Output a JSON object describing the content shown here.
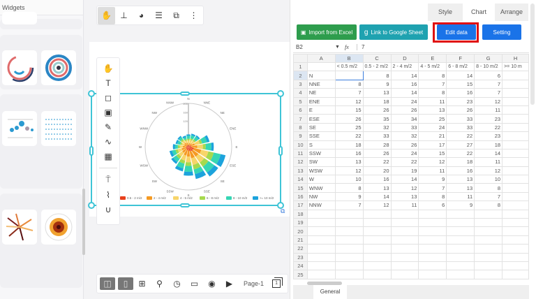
{
  "left_panel": {
    "title": "Widgets"
  },
  "top_toolbar": {
    "icons": [
      "hand-chart-icon",
      "tree-icon",
      "pie-icon",
      "sliders-icon",
      "replace-icon",
      "more-vertical-icon"
    ]
  },
  "vertical_toolbar": {
    "icons": [
      "hand-icon",
      "text-icon",
      "shapes-icon",
      "image-icon",
      "pen-icon",
      "curve-icon",
      "table-icon",
      "paint-roller-icon",
      "brush-icon",
      "magnet-icon"
    ]
  },
  "right_panel": {
    "tabs": [
      {
        "label": "Style"
      },
      {
        "label": "Chart",
        "active": true
      },
      {
        "label": "Arrange"
      }
    ],
    "buttons": {
      "import": "Import from Excel",
      "google": "Link to Google Sheet",
      "edit": "Edit data",
      "setting": "Setting"
    },
    "formula": {
      "cell_ref": "B2",
      "fx": "fx",
      "value": "7"
    },
    "columns": [
      "A",
      "B",
      "C",
      "D",
      "E",
      "F",
      "G",
      "H"
    ],
    "headers": [
      "",
      "< 0.5 m/2",
      "0.5 - 2 m/2",
      "2 - 4 m/2",
      "4 - 5 m/2",
      "6 - 8 m/2",
      "8 - 10 m/2",
      ">= 10 m"
    ],
    "rows": [
      [
        "N",
        "",
        8,
        14,
        8,
        14,
        6
      ],
      [
        "NNE",
        8,
        9,
        16,
        7,
        15,
        7
      ],
      [
        "NE",
        7,
        13,
        14,
        8,
        16,
        7
      ],
      [
        "ENE",
        12,
        18,
        24,
        11,
        23,
        12
      ],
      [
        "E",
        15,
        26,
        26,
        13,
        26,
        11
      ],
      [
        "ESE",
        26,
        35,
        34,
        25,
        33,
        23
      ],
      [
        "SE",
        25,
        32,
        33,
        24,
        33,
        22
      ],
      [
        "SSE",
        22,
        33,
        32,
        21,
        22,
        23
      ],
      [
        "S",
        18,
        28,
        26,
        17,
        27,
        18
      ],
      [
        "SSW",
        16,
        26,
        24,
        15,
        22,
        14
      ],
      [
        "SW",
        13,
        22,
        22,
        12,
        18,
        11
      ],
      [
        "WSW",
        12,
        20,
        19,
        11,
        16,
        12
      ],
      [
        "W",
        10,
        16,
        14,
        9,
        13,
        10
      ],
      [
        "WNW",
        8,
        13,
        12,
        7,
        13,
        8
      ],
      [
        "NW",
        9,
        14,
        13,
        8,
        11,
        7
      ],
      [
        "NNW",
        7,
        12,
        11,
        6,
        9,
        8
      ]
    ],
    "total_rows": 25,
    "sheet_tab": "General"
  },
  "bottom_toolbar": {
    "page_label": "Page-1",
    "page_count": "1"
  },
  "chart_data": {
    "type": "stacked-polar-bar",
    "directions": [
      "N",
      "NNE",
      "NE",
      "ENE",
      "E",
      "ESE",
      "SE",
      "SSE",
      "S",
      "SSW",
      "SW",
      "WSW",
      "W",
      "WNW",
      "NW",
      "NNW"
    ],
    "radial_ticks": [
      120,
      160,
      200
    ],
    "rlim": [
      0,
      200
    ],
    "legend_position": "bottom",
    "series": [
      {
        "name": "0.5 - 2 m/2",
        "color": "#e8401c",
        "values": [
          7,
          8,
          7,
          12,
          15,
          26,
          25,
          22,
          18,
          16,
          13,
          12,
          10,
          8,
          9,
          7
        ]
      },
      {
        "name": "2 - 4 m/2",
        "color": "#f59a23",
        "values": [
          8,
          9,
          13,
          18,
          26,
          35,
          32,
          33,
          28,
          26,
          22,
          20,
          16,
          13,
          14,
          12
        ]
      },
      {
        "name": "4 - 5 m/2",
        "color": "#f7d56a",
        "values": [
          14,
          16,
          14,
          24,
          26,
          34,
          33,
          32,
          26,
          24,
          22,
          19,
          14,
          12,
          13,
          11
        ]
      },
      {
        "name": "6 - 8 m/2",
        "color": "#a6d94e",
        "values": [
          8,
          7,
          8,
          11,
          13,
          25,
          24,
          21,
          17,
          15,
          12,
          11,
          9,
          7,
          8,
          6
        ]
      },
      {
        "name": "8 - 10 m/2",
        "color": "#36d6b4",
        "values": [
          14,
          15,
          16,
          23,
          26,
          33,
          33,
          22,
          27,
          22,
          18,
          16,
          13,
          13,
          11,
          9
        ]
      },
      {
        "name": ">= 10 m/2",
        "color": "#1ca3dc",
        "values": [
          6,
          7,
          7,
          12,
          11,
          23,
          22,
          23,
          18,
          14,
          11,
          12,
          10,
          8,
          7,
          8
        ]
      }
    ]
  }
}
